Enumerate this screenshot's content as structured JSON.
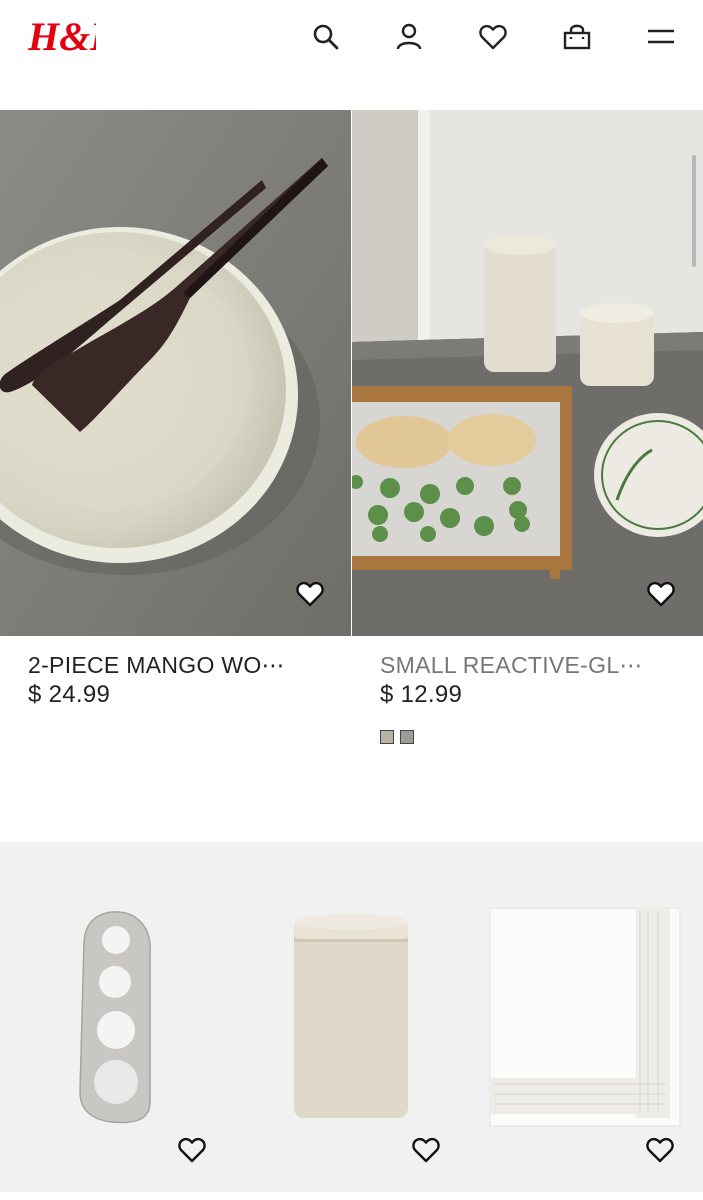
{
  "header": {
    "brand": "H&M",
    "icons": [
      "search-icon",
      "account-icon",
      "favorites-icon",
      "shopping-bag-icon",
      "menu-icon"
    ]
  },
  "products": [
    {
      "name": "2-PIECE MANGO WO⋯",
      "price": "$ 24.99",
      "favorite_icon": "heart-icon",
      "name_color": "#222222"
    },
    {
      "name": "SMALL REACTIVE-GL⋯",
      "price": "$ 12.99",
      "favorite_icon": "heart-icon",
      "name_color": "#777777",
      "swatches": [
        "#b9b3a2",
        "#9c9c97"
      ]
    }
  ],
  "row2": [
    {
      "item": "pasta-measurer",
      "favorite_icon": "heart-icon"
    },
    {
      "item": "ceramic-canister",
      "favorite_icon": "heart-icon"
    },
    {
      "item": "napkin-with-lace-trim",
      "favorite_icon": "heart-icon"
    }
  ],
  "colors": {
    "brand_red": "#e50010",
    "text": "#222222",
    "muted_text": "#777777"
  }
}
